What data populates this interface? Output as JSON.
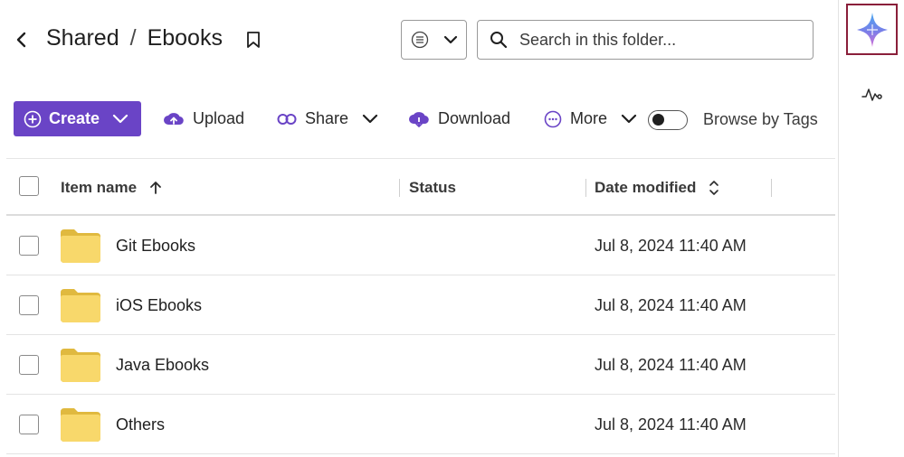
{
  "header": {
    "breadcrumb": [
      "Shared",
      "Ebooks"
    ],
    "breadcrumb_separator": "/",
    "search_placeholder": "Search in this folder..."
  },
  "toolbar": {
    "create_label": "Create",
    "upload_label": "Upload",
    "share_label": "Share",
    "download_label": "Download",
    "more_label": "More",
    "browse_by_tags_label": "Browse by Tags",
    "browse_by_tags_on": false,
    "accent_color": "#6a44c6"
  },
  "table": {
    "columns": {
      "name": "Item name",
      "status": "Status",
      "date_modified": "Date modified"
    },
    "rows": [
      {
        "name": "Git Ebooks",
        "status": "",
        "date_modified": "Jul 8, 2024 11:40 AM"
      },
      {
        "name": "iOS Ebooks",
        "status": "",
        "date_modified": "Jul 8, 2024 11:40 AM"
      },
      {
        "name": "Java Ebooks",
        "status": "",
        "date_modified": "Jul 8, 2024 11:40 AM"
      },
      {
        "name": "Others",
        "status": "",
        "date_modified": "Jul 8, 2024 11:40 AM"
      }
    ]
  },
  "icons": {
    "back": "chevron-left-icon",
    "bookmark": "bookmark-icon",
    "view": "list-view-icon",
    "search": "search-icon",
    "ai_assistant": "sparkle-icon",
    "activity": "activity-icon"
  }
}
